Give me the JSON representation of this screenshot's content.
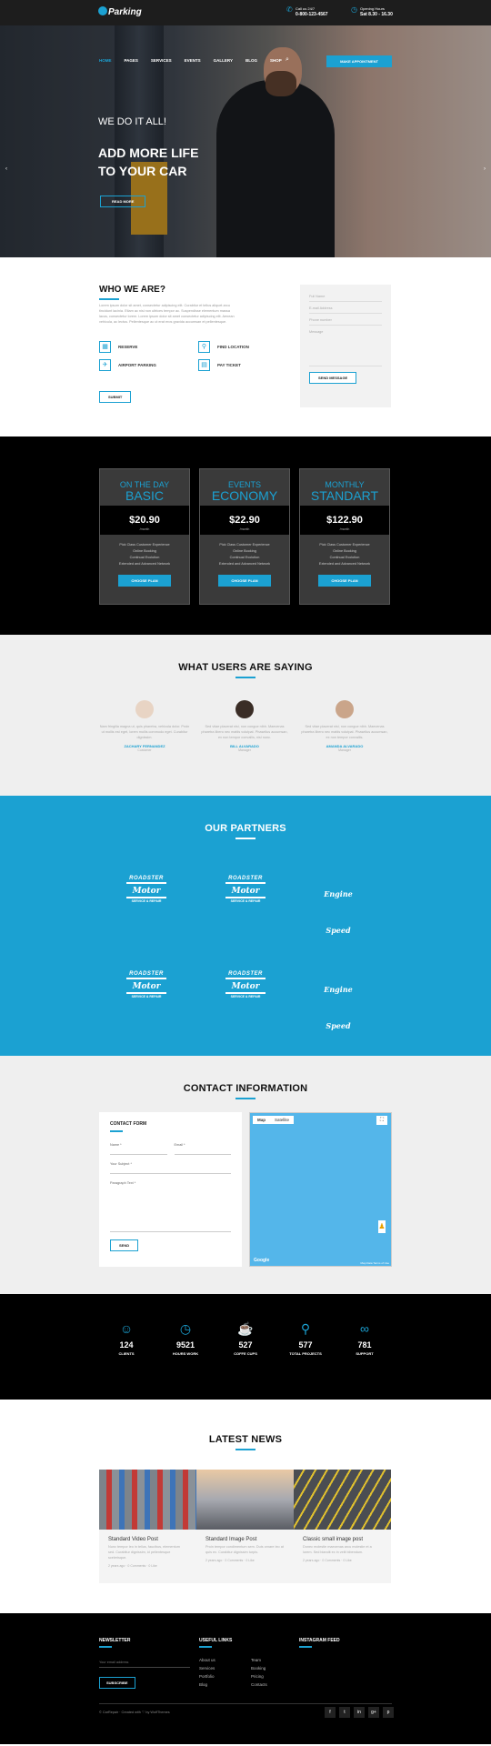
{
  "header": {
    "brand": "Parking",
    "call_label": "Call us 24/7",
    "call_value": "0-800-123-4567",
    "hours_label": "Opening Hours",
    "hours_value": "Sat 8.30 - 16.30"
  },
  "nav": {
    "items": [
      "HOME",
      "PAGES",
      "SERVICES",
      "EVENTS",
      "GALLERY",
      "BLOG",
      "SHOP"
    ],
    "cta": "MAKE APPOINTMENT"
  },
  "hero": {
    "kicker": "WE DO IT ALL!",
    "title1": "ADD MORE LIFE",
    "title2": "TO YOUR CAR",
    "button": "READ MORE"
  },
  "who": {
    "title": "WHO WE ARE?",
    "text": "Lorem ipsum dolor sit amet, consectetur adipiscing elit. Curabitur et tellus aliquet arcu tincidunt lacinia. Etiam ac nisi non ultrices tempor ac. Suspendisse elementum massa lacus, consectetur lorem. Lorem ipsum dolor sit amet consectetur adipiscing elit. Aenean vehicula, ac lectus. Pellentesque ac ut erat eros gravida accumsan et pellentesque.",
    "features": [
      "RESERVE",
      "FIND LOCATION",
      "AIRPORT PARKING",
      "PAY TICKET"
    ],
    "submit": "SUBMIT"
  },
  "quick_form": {
    "name": "Full Name",
    "email": "E-mail Address",
    "phone": "Phone number",
    "message": "Message",
    "send": "SEND MESSAGE"
  },
  "pricing": [
    {
      "line1": "ON THE DAY",
      "line2": "BASIC",
      "price": "$20.90",
      "per": "/month",
      "features": [
        "Pick Class Customer Experience",
        "Online Booking",
        "Continual Evolution",
        "Extended and Advanced Network"
      ],
      "button": "CHOOSE PLAN"
    },
    {
      "line1": "EVENTS",
      "line2": "ECONOMY",
      "price": "$22.90",
      "per": "/month",
      "features": [
        "Pick Class Customer Experience",
        "Online Booking",
        "Continual Evolution",
        "Extended and Advanced Network"
      ],
      "button": "CHOOSE PLAN"
    },
    {
      "line1": "MONTHLY",
      "line2": "STANDART",
      "price": "$122.90",
      "per": "/month",
      "features": [
        "Pick Class Customer Experience",
        "Online Booking",
        "Continual Evolution",
        "Extended and Advanced Network"
      ],
      "button": "CHOOSE PLAN"
    }
  ],
  "testimonials": {
    "title": "WHAT USERS ARE SAYING",
    "items": [
      {
        "quote": "Nam fringilla magna ut, quis pharetra, vehicula dolor. Proin ut mollis est eget, lorem mollis commodo eget. Curabitur dignissim.",
        "name": "ZACHARY FERNANDEZ",
        "role": "Customer",
        "color": "#e8d4c4"
      },
      {
        "quote": "Sed vitae placerat nisi, non congue nibh. Maecenas pharetra libero nec mattis volutpat. Phasellus accumsan, ex non tempor convallis, nisl nunc.",
        "name": "BILL ALVARADO",
        "role": "Manager",
        "color": "#3a2d26"
      },
      {
        "quote": "Sed vitae placerat nisi, non congue nibh. Maecenas pharetra libero nec mattis volutpat. Phasellus accumsan, ex non tempor convallis.",
        "name": "AMANDA ALVARADO",
        "role": "Manager",
        "color": "#caa58a"
      }
    ]
  },
  "partners": {
    "title": "OUR PARTNERS",
    "logo_a": {
      "top": "ROADSTER",
      "mid": "Motor",
      "bot": "SERVICE & REPAIR"
    },
    "logo_b": "Engine Speed"
  },
  "contact": {
    "title": "CONTACT INFORMATION",
    "form_title": "CONTACT FORM",
    "name": "Name *",
    "email": "Email *",
    "subject": "Your Subject *",
    "text": "Paragraph Text *",
    "send": "SEND",
    "map_tab1": "Map",
    "map_tab2": "Satellite",
    "google": "Google",
    "map_footer": "Map Data  Terms of Use"
  },
  "stats": [
    {
      "icon": "person-icon",
      "glyph": "☺",
      "num": "124",
      "label": "CLIENTS"
    },
    {
      "icon": "clock-icon",
      "glyph": "◷",
      "num": "9521",
      "label": "HOURS WORK"
    },
    {
      "icon": "coffee-icon",
      "glyph": "☕",
      "num": "527",
      "label": "COFFE CUPS"
    },
    {
      "icon": "location-icon",
      "glyph": "⚲",
      "num": "577",
      "label": "TOTAL PROJECTS"
    },
    {
      "icon": "support-icon",
      "glyph": "∞",
      "num": "781",
      "label": "SUPPORT"
    }
  ],
  "news": {
    "title": "LATEST NEWS",
    "items": [
      {
        "title": "Standard Video Post",
        "excerpt": "Nunc tempor leo in tellus, faucibus, elementum sed. Curabitur dignissim, id pellentesque scelerisque.",
        "meta": "2 years ago · 0 Comments · 0 Like"
      },
      {
        "title": "Standard Image Post",
        "excerpt": "Proin tempor condimentum sem. Duis ornare leo at quis ex. Curabitur dignissim turpis.",
        "meta": "2 years ago · 0 Comments · 0 Like"
      },
      {
        "title": "Classic small image post",
        "excerpt": "Donec molestie maecenas arcu molestie et a lorem. Sed blandit ex in velit bibendum.",
        "meta": "2 years ago · 0 Comments · 0 Like"
      }
    ]
  },
  "footer": {
    "newsletter": "NEWSLETTER",
    "email_ph": "Your email address",
    "subscribe": "SUBSCRIBE",
    "links_title": "USEFUL LINKS",
    "links_col1": [
      "About us",
      "Services",
      "Portfolio",
      "Blog"
    ],
    "links_col2": [
      "Team",
      "Booking",
      "Pricing",
      "Contacts"
    ],
    "insta": "INSTAGRAM FEED",
    "copyright": "© CarRepair · Created with ♡ by WolfThemes",
    "social": [
      "f",
      "t",
      "in",
      "g+",
      "p"
    ]
  },
  "colors": {
    "accent": "#1ba1d2",
    "dark": "#000000",
    "light": "#efefef"
  }
}
